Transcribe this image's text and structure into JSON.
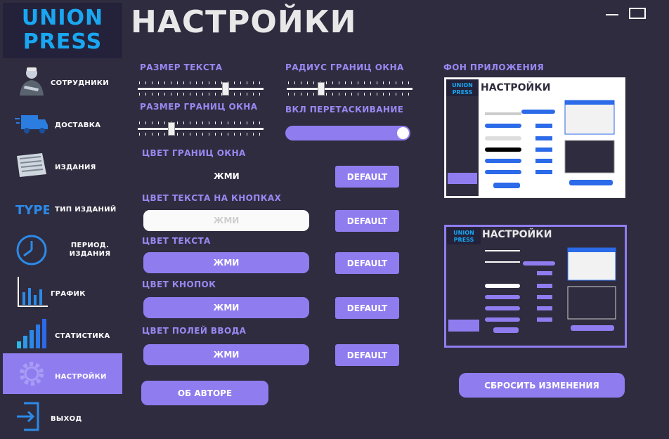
{
  "logo": {
    "line1": "UNION",
    "line2": "PRESS"
  },
  "page_title": "НАСТРОЙКИ",
  "sidebar": {
    "items": [
      {
        "label": "СОТРУДНИКИ",
        "icon": "worker-icon"
      },
      {
        "label": "ДОСТАВКА",
        "icon": "truck-icon"
      },
      {
        "label": "ИЗДАНИЯ",
        "icon": "newspaper-icon"
      },
      {
        "label": "ТИП ИЗДАНИЙ",
        "icon": "type-icon"
      },
      {
        "label": "ПЕРИОД. ИЗДАНИЯ",
        "icon": "clock-icon"
      },
      {
        "label": "ГРАФИК",
        "icon": "chart-icon"
      },
      {
        "label": "СТАТИСТИКА",
        "icon": "bar-chart-icon"
      },
      {
        "label": "НАСТРОЙКИ",
        "icon": "gear-icon"
      },
      {
        "label": "ВЫХОД",
        "icon": "exit-icon"
      }
    ],
    "active": "НАСТРОЙКИ"
  },
  "settings": {
    "text_size_label": "РАЗМЕР ТЕКСТА",
    "border_radius_label": "РАДИУС ГРАНИЦ ОКНА",
    "border_size_label": "РАЗМЕР ГРАНИЦ ОКНА",
    "drag_label": "ВКЛ ПЕРЕТАСКИВАНИЕ",
    "drag_enabled": true,
    "border_color_label": "ЦВЕТ ГРАНИЦ ОКНА",
    "button_text_color_label": "ЦВЕТ ТЕКСТА НА КНОПКАХ",
    "text_color_label": "ЦВЕТ ТЕКСТА",
    "button_color_label": "ЦВЕТ КНОПОК",
    "input_color_label": "ЦВЕТ ПОЛЕЙ ВВОДА",
    "press_label": "ЖМИ",
    "default_label": "DEFAULT",
    "about_label": "ОБ АВТОРЕ",
    "background_label": "ФОН ПРИЛОЖЕНИЯ",
    "reset_label": "СБРОСИТЬ ИЗМЕНЕНИЯ"
  },
  "colors": {
    "background": "#2f2c3f",
    "accent": "#8f7df0",
    "logo": "#1aa7f2",
    "label": "#9a88f2"
  }
}
